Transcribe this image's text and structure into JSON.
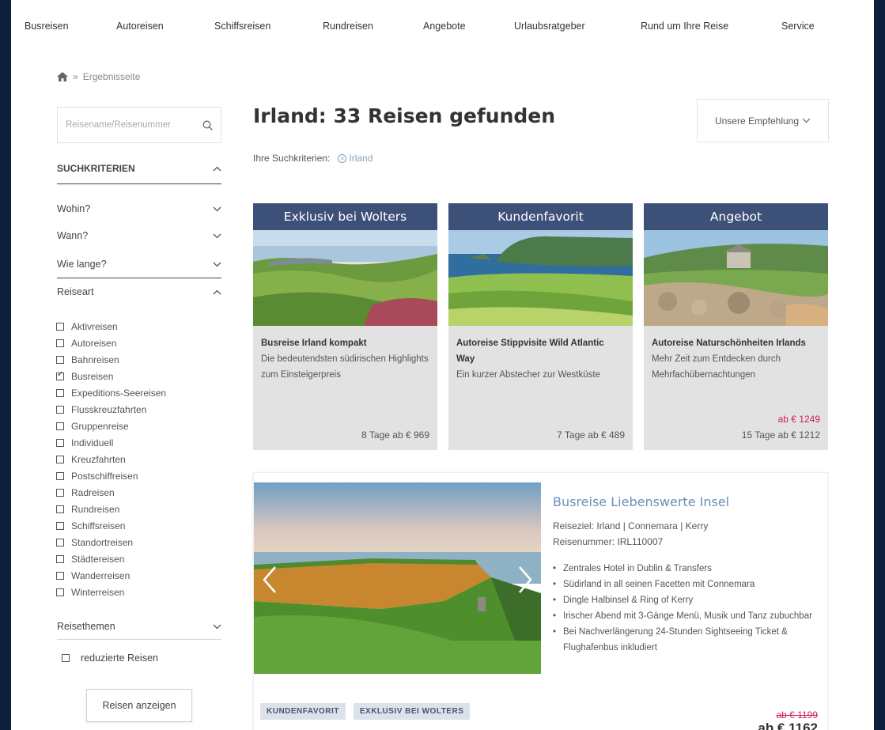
{
  "nav": [
    "Busreisen",
    "Autoreisen",
    "Schiffsreisen",
    "Rundreisen",
    "Angebote",
    "Urlaubsratgeber",
    "Rund um Ihre Reise",
    "Service"
  ],
  "breadcrumb": {
    "current": "Ergebnisseite",
    "separator": "»"
  },
  "sidebar": {
    "search_placeholder": "Reisename/Reisenummer",
    "criteria_header": "SUCHKRITERIEN",
    "filters": [
      "Wohin?",
      "Wann?",
      "Wie lange?"
    ],
    "reiseart_header": "Reiseart",
    "reiseart": [
      {
        "label": "Aktivreisen",
        "checked": false
      },
      {
        "label": "Autoreisen",
        "checked": false
      },
      {
        "label": "Bahnreisen",
        "checked": false
      },
      {
        "label": "Busreisen",
        "checked": true
      },
      {
        "label": "Expeditions-Seereisen",
        "checked": false
      },
      {
        "label": "Flusskreuzfahrten",
        "checked": false
      },
      {
        "label": "Gruppenreise",
        "checked": false
      },
      {
        "label": "Individuell",
        "checked": false
      },
      {
        "label": "Kreuzfahrten",
        "checked": false
      },
      {
        "label": "Postschiffreisen",
        "checked": false
      },
      {
        "label": "Radreisen",
        "checked": false
      },
      {
        "label": "Rundreisen",
        "checked": false
      },
      {
        "label": "Schiffsreisen",
        "checked": false
      },
      {
        "label": "Standortreisen",
        "checked": false
      },
      {
        "label": "Städtereisen",
        "checked": false
      },
      {
        "label": "Wanderreisen",
        "checked": false
      },
      {
        "label": "Winterreisen",
        "checked": false
      }
    ],
    "themes_header": "Reisethemen",
    "reduced_label": "reduzierte Reisen",
    "show_button": "Reisen anzeigen"
  },
  "main": {
    "title": "Irland: 33 Reisen gefunden",
    "sort_label": "Unsere Empfehlung",
    "criteria_label": "Ihre Suchkriterien:",
    "criteria_chip": "Irland",
    "cards": [
      {
        "banner": "Exklusiv bei Wolters",
        "title": "Busreise Irland kompakt",
        "desc": "Die bedeutendsten südirischen Highlights zum Einsteigerpreis",
        "old_price": "",
        "price": "8 Tage ab € 969"
      },
      {
        "banner": "Kundenfavorit",
        "title": "Autoreise Stippvisite Wild Atlantic Way",
        "desc": "Ein kurzer Abstecher zur Westküste",
        "old_price": "",
        "price": "7 Tage ab € 489"
      },
      {
        "banner": "Angebot",
        "title": "Autoreise Naturschönheiten Irlands",
        "desc": "Mehr Zeit zum Entdecken durch Mehrfachübernachtungen",
        "old_price": "ab € 1249",
        "price": "15 Tage ab € 1212"
      }
    ],
    "featured": {
      "title": "Busreise Liebenswerte Insel",
      "destination": "Reiseziel: Irland | Connemara | Kerry",
      "number": "Reisenummer: IRL110007",
      "bullets": [
        "Zentrales Hotel in Dublin & Transfers",
        "Südirland in all seinen Facetten mit Connemara",
        "Dingle Halbinsel & Ring of Kerry",
        "Irischer Abend mit 3-Gänge Menü, Musik und Tanz zubuchbar",
        "Bei Nachverlängerung 24-Stunden Sightseeing Ticket & Flughafenbus inkludiert"
      ],
      "badges": [
        "KUNDENFAVORIT",
        "EXKLUSIV BEI WOLTERS"
      ],
      "old_price": "ab € 1199",
      "price": "ab € 1162"
    }
  },
  "colors": {
    "banner": "#3d5178",
    "sale": "#d02050",
    "link": "#6b8fb8",
    "page_bg": "#0d1f3c"
  }
}
